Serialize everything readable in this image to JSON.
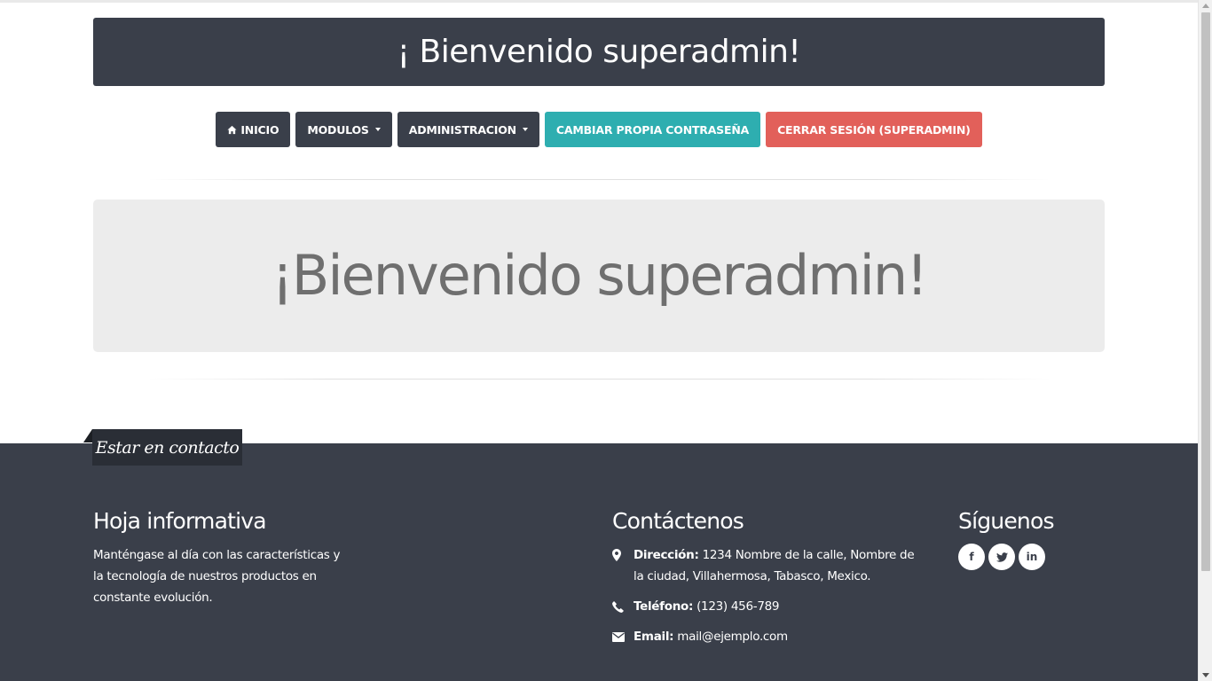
{
  "header": {
    "title": "¡ Bienvenido superadmin!"
  },
  "nav": {
    "home": "INICIO",
    "modules": "MODULOS",
    "admin": "ADMINISTRACION",
    "change_password": "CAMBIAR PROPIA CONTRASEÑA",
    "logout": "CERRAR SESIÓN (SUPERADMIN)"
  },
  "jumbotron": {
    "title": "¡Bienvenido superadmin!"
  },
  "footer": {
    "tab_label": "Estar en contacto",
    "newsletter": {
      "heading": "Hoja informativa",
      "text": "Manténgase al día con las características y la tecnología de nuestros productos en constante evolución."
    },
    "contact": {
      "heading": "Contáctenos",
      "address_label": "Dirección:",
      "address_value": "1234 Nombre de la calle, Nombre de la ciudad, Villahermosa, Tabasco, Mexico.",
      "phone_label": "Teléfono:",
      "phone_value": "(123) 456-789",
      "email_label": "Email:",
      "email_value": "mail@ejemplo.com"
    },
    "follow": {
      "heading": "Síguenos",
      "facebook": "f",
      "twitter": "t",
      "linkedin": "in"
    }
  },
  "colors": {
    "dark": "#3a3f4a",
    "teal": "#2eaeb0",
    "red": "#e2605a",
    "jumbotron_bg": "#ececec"
  },
  "icons": [
    "home-icon",
    "caret-down-icon",
    "map-pin-icon",
    "phone-icon",
    "envelope-icon",
    "facebook-icon",
    "twitter-icon",
    "linkedin-icon"
  ]
}
